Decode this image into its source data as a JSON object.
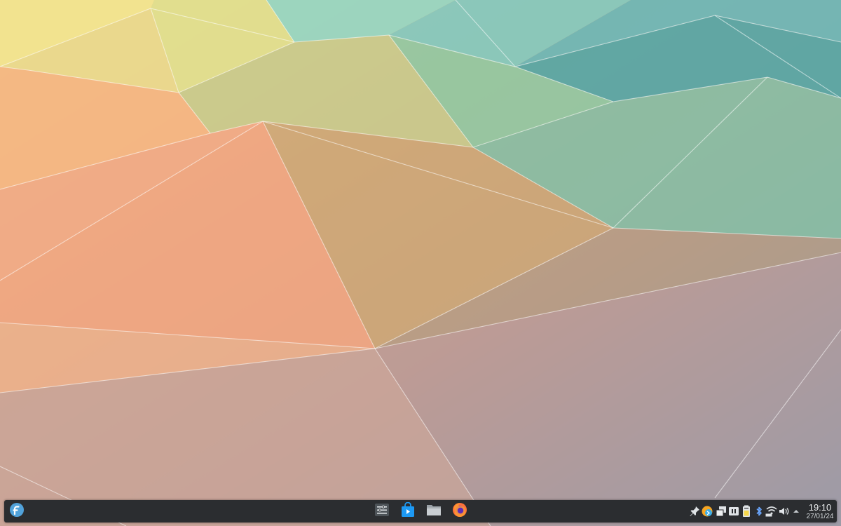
{
  "desktop": {
    "wallpaper_name": "kde-plasma-geometric-wallpaper"
  },
  "taskbar": {
    "launcher_icon": "fedora-logo-icon",
    "pinned_apps": [
      {
        "name": "system-monitor",
        "icon": "system-monitor-icon"
      },
      {
        "name": "discover",
        "icon": "discover-store-icon"
      },
      {
        "name": "files",
        "icon": "folder-icon"
      },
      {
        "name": "firefox",
        "icon": "firefox-icon"
      }
    ],
    "tray_icons": [
      "pin-icon",
      "updates-icon",
      "clipboard-icon",
      "pause-media-icon",
      "battery-icon",
      "bluetooth-icon",
      "network-icon",
      "volume-icon",
      "expand-arrow-icon"
    ],
    "clock": {
      "time": "19:10",
      "date": "27/01/24"
    }
  },
  "colors": {
    "panel": "#2b2d30",
    "accent": "#3daee9",
    "fedora": "#51a2da"
  }
}
